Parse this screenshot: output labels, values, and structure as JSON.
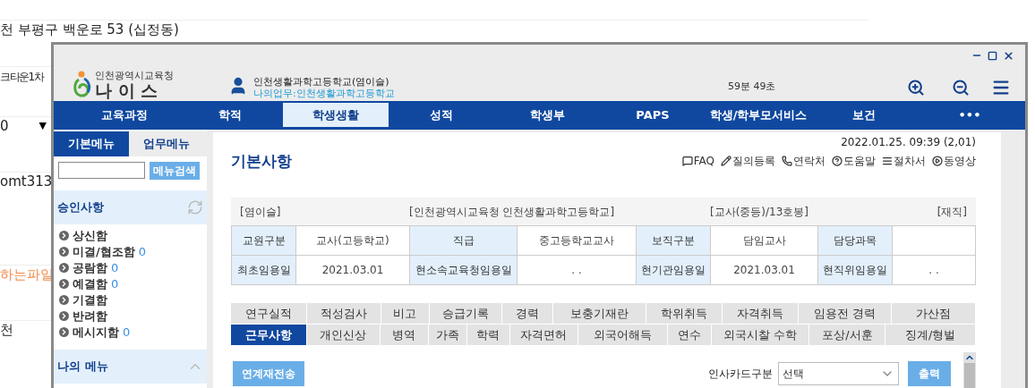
{
  "page_behind": {
    "lines": [
      {
        "text": "천 부평구 백운로 53 (십정동)",
        "kind": "text"
      },
      {
        "text": "크타운1차",
        "kind": "text"
      },
      {
        "text": "0",
        "kind": "select",
        "arrow": "▼"
      },
      {
        "text": "omt313",
        "kind": "text"
      },
      {
        "text": "하는파일",
        "kind": "warning"
      },
      {
        "text": "천",
        "kind": "text"
      }
    ]
  },
  "window": {
    "org": "인천광역시교육청",
    "app_name": "나 이 스",
    "user": {
      "name": "인천생활과학고등학교(염이슬)",
      "work": "나의업무:인천생활과학고등학교"
    },
    "timer": "59분 49초",
    "nav": [
      {
        "label": "교육과정",
        "selected": false
      },
      {
        "label": "학적",
        "selected": false
      },
      {
        "label": "학생생활",
        "selected": true
      },
      {
        "label": "성적",
        "selected": false
      },
      {
        "label": "학생부",
        "selected": false
      },
      {
        "label": "PAPS",
        "selected": false
      },
      {
        "label": "학생/학부모서비스",
        "selected": false
      },
      {
        "label": "보건",
        "selected": false
      },
      {
        "label": "•••",
        "selected": false
      }
    ],
    "sidebar": {
      "tabs": [
        {
          "label": "기본메뉴",
          "selected": true
        },
        {
          "label": "업무메뉴",
          "selected": false
        }
      ],
      "search_button": "메뉴검색",
      "sections": [
        {
          "title": "승인사항",
          "kind": "refresh",
          "items": [
            {
              "label": "상신함"
            },
            {
              "label": "미결/협조함",
              "count": "0"
            },
            {
              "label": "공람함",
              "count": "0"
            },
            {
              "label": "예결함",
              "count": "0"
            },
            {
              "label": "기결함"
            },
            {
              "label": "반려함"
            },
            {
              "label": "메시지함",
              "count": "0"
            }
          ]
        },
        {
          "title": "나의 메뉴",
          "kind": "collapse"
        }
      ]
    },
    "content": {
      "datetime": "2022.01.25. 09:39 (2,01)",
      "title": "기본사항",
      "links": [
        {
          "label": "FAQ",
          "kind": "faq"
        },
        {
          "label": "질의등록",
          "kind": "write"
        },
        {
          "label": "연락처",
          "kind": "phone"
        },
        {
          "label": "도움말",
          "kind": "help"
        },
        {
          "label": "절차서",
          "kind": "doc"
        },
        {
          "label": "동영상",
          "kind": "video"
        }
      ],
      "summary": [
        "[염이슬]",
        "[인천광역시교육청 인천생활과학고등학교]",
        "[교사(중등)/13호봉]",
        "[재직]"
      ],
      "info_rows": [
        [
          {
            "text": "교원구분",
            "kind": "label"
          },
          {
            "text": "교사(고등학교)",
            "kind": "value"
          },
          {
            "text": "직급",
            "kind": "label"
          },
          {
            "text": "중고등학교교사",
            "kind": "value"
          },
          {
            "text": "보직구분",
            "kind": "label"
          },
          {
            "text": "담임교사",
            "kind": "value"
          },
          {
            "text": "담당과목",
            "kind": "label"
          },
          {
            "text": "",
            "kind": "value"
          }
        ],
        [
          {
            "text": "최초임용일",
            "kind": "label"
          },
          {
            "text": "2021.03.01",
            "kind": "value"
          },
          {
            "text": "현소속교육청임용일",
            "kind": "label"
          },
          {
            "text": ". .",
            "kind": "value"
          },
          {
            "text": "현기관임용일",
            "kind": "label"
          },
          {
            "text": "2021.03.01",
            "kind": "value"
          },
          {
            "text": "현직위임용일",
            "kind": "label"
          },
          {
            "text": ". .",
            "kind": "value"
          }
        ]
      ],
      "tabs_row_1": [
        {
          "label": "연구실적",
          "selected": false
        },
        {
          "label": "적성검사",
          "selected": false
        },
        {
          "label": "비고",
          "selected": false
        },
        {
          "label": "승급기록",
          "selected": false
        },
        {
          "label": "경력",
          "selected": false
        },
        {
          "label": "보충기재란",
          "selected": false
        },
        {
          "label": "학위취득",
          "selected": false
        },
        {
          "label": "자격취득",
          "selected": false
        },
        {
          "label": "임용전 경력",
          "selected": false
        },
        {
          "label": "가산점",
          "selected": false
        }
      ],
      "tabs_row_2": [
        {
          "label": "근무사항",
          "selected": true
        },
        {
          "label": "개인신상",
          "selected": false
        },
        {
          "label": "병역",
          "selected": false
        },
        {
          "label": "가족",
          "selected": false
        },
        {
          "label": "학력",
          "selected": false
        },
        {
          "label": "자격면허",
          "selected": false
        },
        {
          "label": "외국어해득",
          "selected": false
        },
        {
          "label": "연수",
          "selected": false
        },
        {
          "label": "외국시찰 수학",
          "selected": false
        },
        {
          "label": "포상/서훈",
          "selected": false
        },
        {
          "label": "징계/형벌",
          "selected": false
        }
      ],
      "toolbar": {
        "resend_button": "연계재전송",
        "card_type_label": "인사카드구분",
        "card_type_value": "선택",
        "print_button": "출력"
      }
    }
  }
}
